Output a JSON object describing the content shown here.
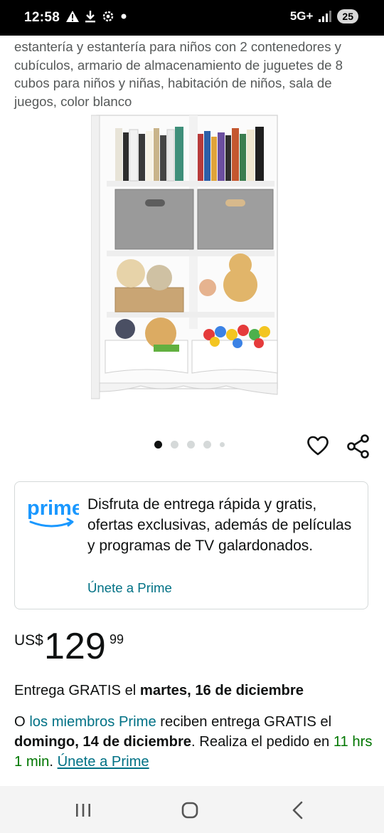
{
  "status_bar": {
    "time": "12:58",
    "network": "5G+",
    "battery": "25",
    "icons": [
      "alert-icon",
      "download-icon",
      "settings-icon",
      "dot-icon",
      "signal-icon"
    ]
  },
  "product": {
    "title": "estantería y estantería para niños con 2 contenedores y cubículos, armario de almacenamiento de juguetes de 8 cubos para niños y niñas, habitación de niños, sala de juegos, color blanco",
    "image_alt": "White toy storage shelf with books, fabric bins, plush toys and ball pit",
    "carousel": {
      "dots": 5,
      "active": 0
    }
  },
  "prime_card": {
    "logo_text": "prime",
    "text": "Disfruta de entrega rápida y gratis, ofertas exclusivas, además de películas y programas de TV galardonados.",
    "link": "Únete a Prime"
  },
  "price": {
    "currency": "US$",
    "whole": "129",
    "fraction": "99"
  },
  "delivery": {
    "prefix": "Entrega GRATIS el ",
    "date": "martes, 16 de diciembre"
  },
  "member_delivery": {
    "prefix": "O ",
    "link": "los miembros Prime",
    "middle": " reciben entrega GRATIS el ",
    "date": "domingo, 14 de diciembre",
    "after_date": ". Realiza el pedido en ",
    "countdown": "11 hrs 1 min",
    "sep": ". ",
    "join_link": "Únete a Prime"
  },
  "colors": {
    "link": "#007185",
    "prime_blue": "#1a98ff",
    "countdown_green": "#007600",
    "text": "#0f1111",
    "muted": "#565959"
  }
}
